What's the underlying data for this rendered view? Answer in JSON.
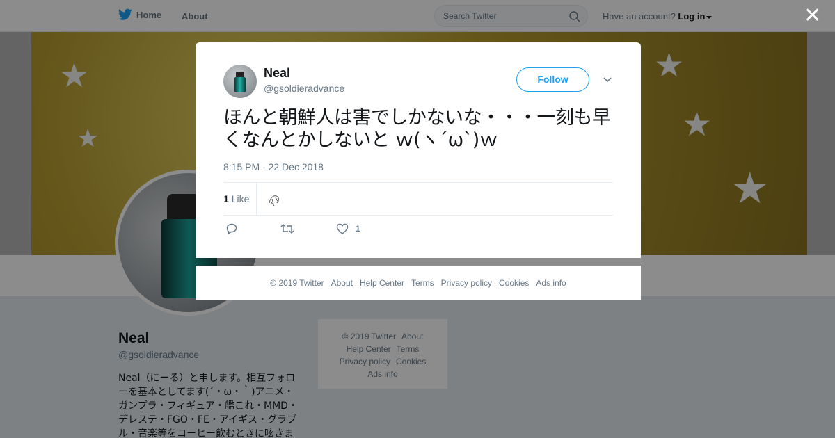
{
  "topbar": {
    "home_label": "Home",
    "about_label": "About",
    "search_placeholder": "Search Twitter",
    "account_prompt": "Have an account?",
    "login_label": "Log in"
  },
  "profile": {
    "name": "Neal",
    "handle": "@gsoldieradvance",
    "bio": "Neal（にーる）と申します。相互フォローを基本としてます(´・ω・｀)アニメ・ガンプラ・フィギュア・艦これ・MMD・デレステ・FGO・FE・アイギス・グラブル・音楽等をコーヒー飲むときに呟きま"
  },
  "sidebar_footer": {
    "copyright": "© 2019 Twitter",
    "about": "About",
    "help": "Help Center",
    "terms": "Terms",
    "privacy": "Privacy policy",
    "cookies": "Cookies",
    "ads": "Ads info"
  },
  "tweet": {
    "author_name": "Neal",
    "author_handle": "@gsoldieradvance",
    "follow_label": "Follow",
    "text": "ほんと朝鮮人は害でしかないな・・・一刻も早くなんとかしないと ｗ(ヽ´ω`)ｗ",
    "timestamp": "8:15 PM - 22 Dec 2018",
    "like_count": "1",
    "like_label": "Like",
    "action_like_count": "1"
  },
  "modal_footer": {
    "copyright": "© 2019 Twitter",
    "about": "About",
    "help": "Help Center",
    "terms": "Terms",
    "privacy": "Privacy policy",
    "cookies": "Cookies",
    "ads": "Ads info"
  },
  "close_glyph": "✕",
  "colors": {
    "accent": "#1da1f2",
    "muted": "#657786",
    "text": "#14171a"
  }
}
